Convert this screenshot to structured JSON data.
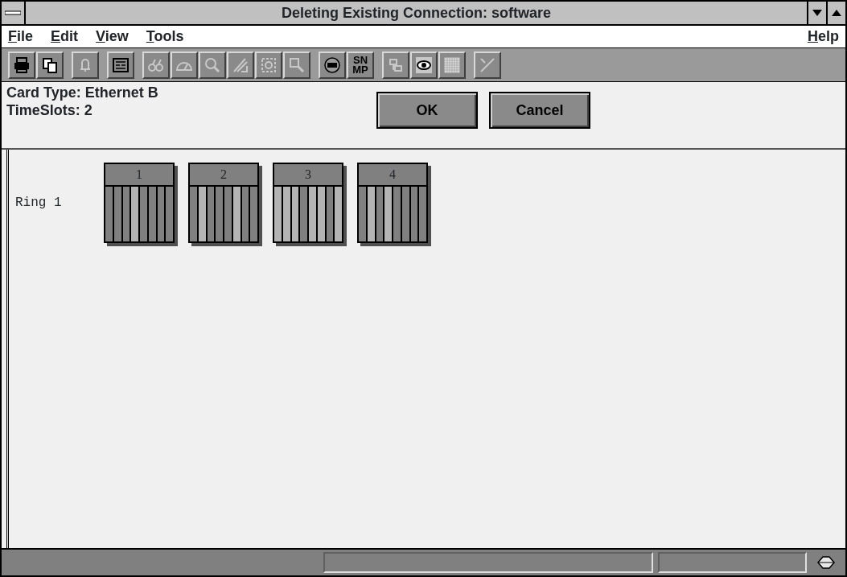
{
  "window": {
    "title": "Deleting Existing Connection: software"
  },
  "menu": [
    {
      "label": "File"
    },
    {
      "label": "Edit"
    },
    {
      "label": "View"
    },
    {
      "label": "Tools"
    }
  ],
  "help_menu": {
    "label": "Help"
  },
  "toolbar": [
    [
      {
        "disabled": false
      },
      {
        "disabled": false
      }
    ],
    [
      {
        "disabled": true
      }
    ],
    [
      {
        "disabled": false
      }
    ],
    [
      {
        "disabled": true
      },
      {
        "disabled": true
      },
      {
        "disabled": true
      },
      {
        "disabled": true
      },
      {
        "disabled": true
      },
      {
        "disabled": true
      }
    ],
    [
      {
        "disabled": false
      },
      {
        "disabled": false,
        "label": "SN MP"
      }
    ],
    [
      {
        "disabled": true
      },
      {
        "disabled": false
      },
      {
        "disabled": true
      }
    ],
    [
      {
        "disabled": true
      }
    ]
  ],
  "info": {
    "card_type": "Card Type: Ethernet B",
    "timeslots": "TimeSlots: 2"
  },
  "buttons": [
    "OK",
    "Cancel"
  ],
  "ring": {
    "label": "Ring 1",
    "cards": [
      {
        "number": "1",
        "slots": [
          false,
          false,
          false,
          true,
          false,
          false,
          false,
          false
        ]
      },
      {
        "number": "2",
        "slots": [
          false,
          true,
          false,
          false,
          false,
          true,
          false,
          false
        ]
      },
      {
        "number": "3",
        "slots": [
          true,
          true,
          true,
          false,
          true,
          true,
          false,
          true
        ]
      },
      {
        "number": "4",
        "slots": [
          false,
          true,
          false,
          true,
          false,
          false,
          false,
          false
        ]
      }
    ]
  }
}
